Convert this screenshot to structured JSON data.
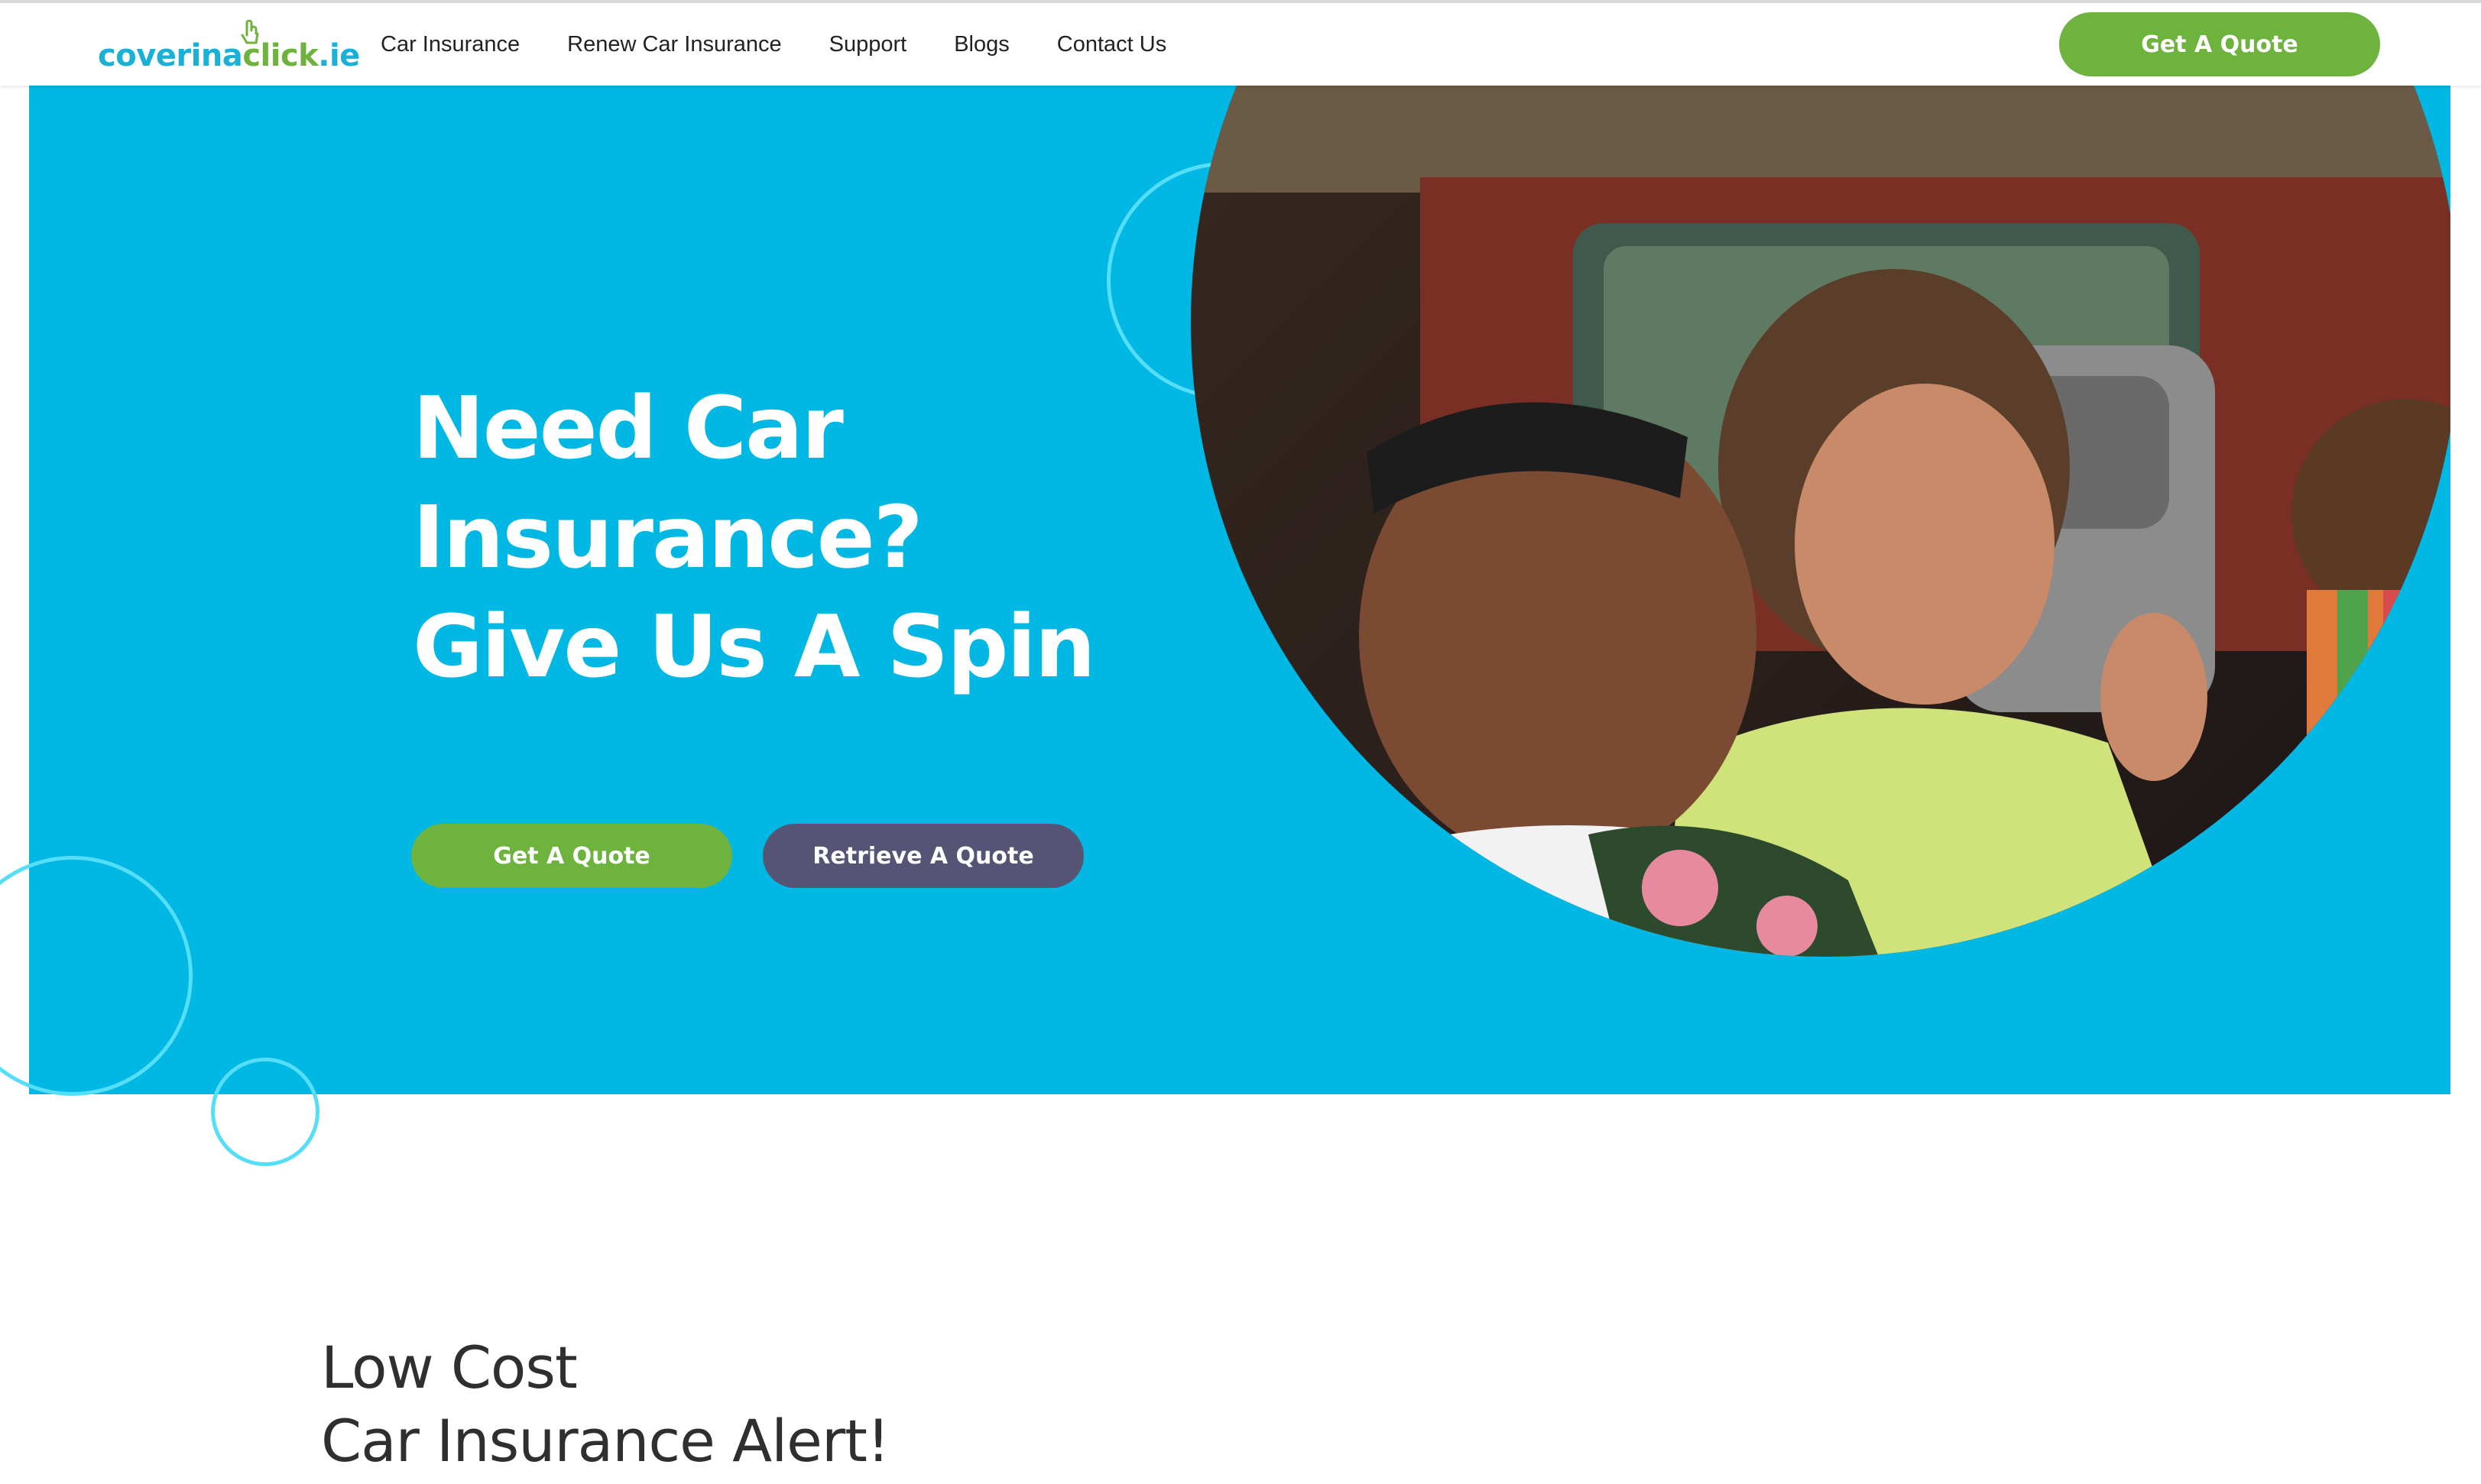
{
  "header": {
    "logo": {
      "part1": "coverina",
      "part2": "click",
      "part3": ".ie"
    },
    "nav": [
      {
        "label": "Car Insurance"
      },
      {
        "label": "Renew Car Insurance"
      },
      {
        "label": "Support"
      },
      {
        "label": "Blogs"
      },
      {
        "label": "Contact Us"
      }
    ],
    "cta_label": "Get A Quote"
  },
  "hero": {
    "title_line1": "Need Car",
    "title_line2": "Insurance?",
    "title_line3": "Give Us A Spin",
    "primary_button": "Get A Quote",
    "secondary_button": "Retrieve A Quote"
  },
  "section": {
    "title_line1": "Low Cost",
    "title_line2": "Car Insurance Alert!"
  },
  "colors": {
    "brand_blue": "#00b8e3",
    "brand_green": "#6fb33f",
    "retrieve_button": "#555475",
    "ring_accent": "#55def7"
  },
  "icons": [
    "cursor-hand-icon"
  ]
}
